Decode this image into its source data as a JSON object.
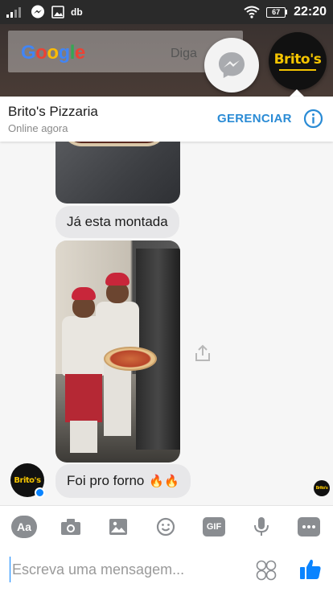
{
  "status_bar": {
    "time": "22:20",
    "battery": "67",
    "data_label": "db"
  },
  "background": {
    "google_logo": "Google",
    "search_hint": "Diga"
  },
  "chat_heads": {
    "brand_logo": "Brito's"
  },
  "header": {
    "contact_name": "Brito's Pizzaria",
    "status": "Online agora",
    "manage_label": "GERENCIAR"
  },
  "messages": [
    {
      "type": "image",
      "from": "contact"
    },
    {
      "type": "text",
      "from": "contact",
      "text": "Já esta montada"
    },
    {
      "type": "image",
      "from": "contact"
    },
    {
      "type": "text",
      "from": "contact",
      "text": "Foi pro forno",
      "emoji": "🔥🔥"
    }
  ],
  "toolbar": {
    "aa_label": "Aa",
    "gif_label": "GIF"
  },
  "composer": {
    "placeholder": "Escreva uma mensagem..."
  },
  "colors": {
    "accent": "#2a8bd5",
    "brand_yellow": "#f4c400",
    "bubble": "#e7e7e9",
    "messenger_blue": "#0a84ff"
  }
}
